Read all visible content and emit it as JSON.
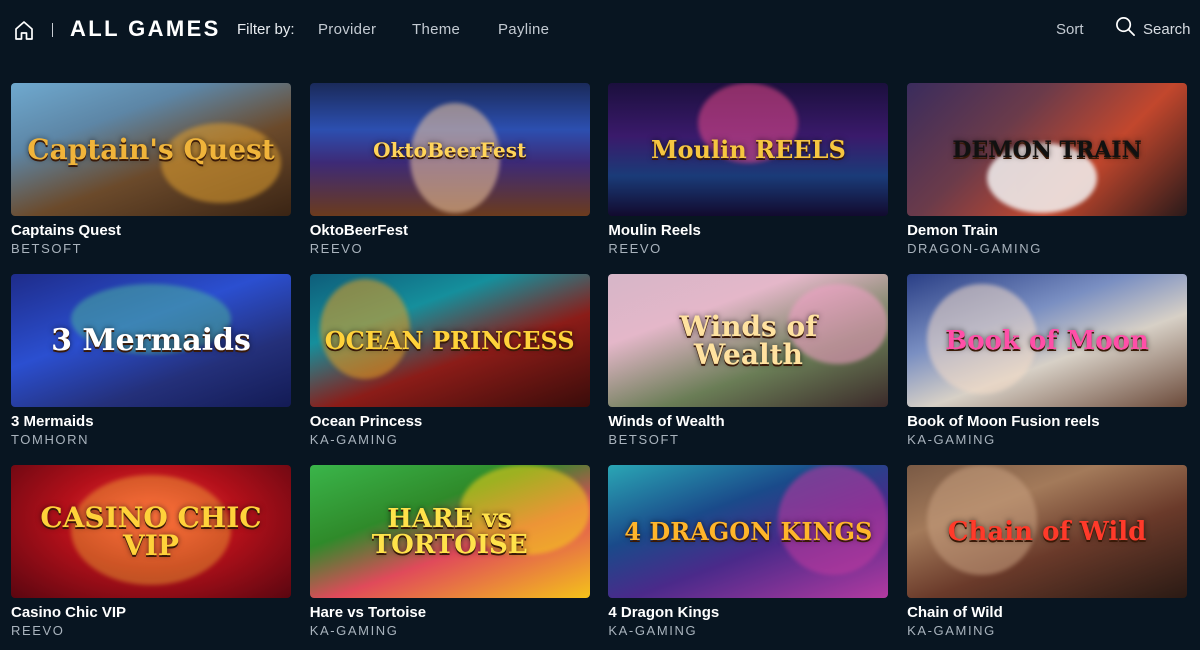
{
  "header": {
    "home_icon": "home-icon",
    "title": "ALL GAMES",
    "filter_label": "Filter by:",
    "filters": [
      "Provider",
      "Theme",
      "Payline"
    ],
    "sort_label": "Sort",
    "search_label": "Search",
    "search_icon": "search-icon"
  },
  "games": [
    {
      "name": "Captains Quest",
      "provider": "BETSOFT",
      "art_text": "Captain's Quest",
      "art_color": "#f0b43a"
    },
    {
      "name": "OktoBeerFest",
      "provider": "REEVO",
      "art_text": "OktoBeerFest",
      "art_color": "#ffd45a"
    },
    {
      "name": "Moulin Reels",
      "provider": "REEVO",
      "art_text": "Moulin REELS",
      "art_color": "#f6c640"
    },
    {
      "name": "Demon Train",
      "provider": "DRAGON-GAMING",
      "art_text": "DEMON TRAIN",
      "art_color": "#111111"
    },
    {
      "name": "3 Mermaids",
      "provider": "TOMHORN",
      "art_text": "3 Mermaids",
      "art_color": "#ffffff"
    },
    {
      "name": "Ocean Princess",
      "provider": "KA-GAMING",
      "art_text": "OCEAN PRINCESS",
      "art_color": "#ffd23a"
    },
    {
      "name": "Winds of Wealth",
      "provider": "BETSOFT",
      "art_text": "Winds of Wealth",
      "art_color": "#ffe2a0"
    },
    {
      "name": "Book of Moon Fusion reels",
      "provider": "KA-GAMING",
      "art_text": "Book of Moon",
      "art_color": "#ff4fa8"
    },
    {
      "name": "Casino Chic VIP",
      "provider": "REEVO",
      "art_text": "CASINO CHIC VIP",
      "art_color": "#ffd23a"
    },
    {
      "name": "Hare vs Tortoise",
      "provider": "KA-GAMING",
      "art_text": "HARE vs TORTOISE",
      "art_color": "#ffe24a"
    },
    {
      "name": "4 Dragon Kings",
      "provider": "KA-GAMING",
      "art_text": "4 DRAGON KINGS",
      "art_color": "#ffb52a"
    },
    {
      "name": "Chain of Wild",
      "provider": "KA-GAMING",
      "art_text": "Chain of Wild",
      "art_color": "#ff3a2a"
    }
  ]
}
